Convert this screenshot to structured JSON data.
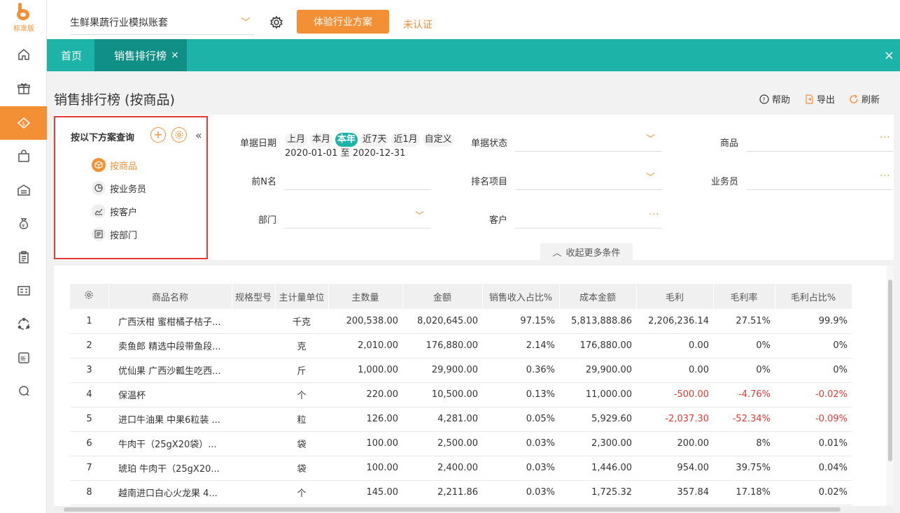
{
  "brand": {
    "logo_text": "标准版",
    "accent": "#f39036",
    "teal": "#1eb3a8"
  },
  "rail": [
    {
      "icon": "home-icon"
    },
    {
      "icon": "gift-icon"
    },
    {
      "icon": "sales-icon",
      "active": true
    },
    {
      "icon": "shopping-bag-icon"
    },
    {
      "icon": "warehouse-icon"
    },
    {
      "icon": "money-bag-icon"
    },
    {
      "icon": "clipboard-icon"
    },
    {
      "icon": "report-icon"
    },
    {
      "icon": "cycle-icon"
    },
    {
      "icon": "new-icon"
    },
    {
      "icon": "chat-icon"
    }
  ],
  "topbar": {
    "account_name": "生鲜果蔬行业模拟账套",
    "try_button": "体验行业方案",
    "verify_status": "未认证"
  },
  "tabs": {
    "home": "首页",
    "active": "销售排行榜",
    "close": "×",
    "close_all": "×"
  },
  "page": {
    "title": "销售排行榜 (按商品)",
    "help": "帮助",
    "export": "导出",
    "refresh": "刷新"
  },
  "scheme": {
    "title": "按以下方案查询",
    "add": "+",
    "collapse": "«",
    "items": [
      {
        "label": "按商品",
        "active": true
      },
      {
        "label": "按业务员"
      },
      {
        "label": "按客户"
      },
      {
        "label": "按部门"
      }
    ]
  },
  "filters": {
    "date_label": "单据日期",
    "date_chips": [
      "上月",
      "本月",
      "本年",
      "近7天",
      "近1月",
      "自定义"
    ],
    "date_selected": "本年",
    "date_range": "2020-01-01 至 2020-12-31",
    "status_label": "单据状态",
    "goods_label": "商品",
    "topn_label": "前N名",
    "rank_label": "排名项目",
    "salesman_label": "业务员",
    "dept_label": "部门",
    "customer_label": "客户",
    "more_toggle": "收起更多条件",
    "dots": "···"
  },
  "table": {
    "headers": [
      "商品名称",
      "规格型号",
      "主计量单位",
      "主数量",
      "金额",
      "销售收入占比%",
      "成本金额",
      "毛利",
      "毛利率",
      "毛利占比%"
    ],
    "rows": [
      [
        "1",
        "广西沃柑 蜜柑橘子桔子...",
        "",
        "千克",
        "200,538.00",
        "8,020,645.00",
        "97.15%",
        "5,813,888.86",
        "2,206,236.14",
        "27.51%",
        "99.9%"
      ],
      [
        "2",
        "卖鱼郎 精选中段带鱼段...",
        "",
        "克",
        "2,010.00",
        "176,880.00",
        "2.14%",
        "176,880.00",
        "0.00",
        "0%",
        "0%"
      ],
      [
        "3",
        "优仙果 广西沙瓤生吃西...",
        "",
        "斤",
        "1,000.00",
        "29,900.00",
        "0.36%",
        "29,900.00",
        "0.00",
        "0%",
        "0%"
      ],
      [
        "4",
        "保温杯",
        "",
        "个",
        "220.00",
        "10,500.00",
        "0.13%",
        "11,000.00",
        "-500.00",
        "-4.76%",
        "-0.02%"
      ],
      [
        "5",
        "进口牛油果 中果6粒装 ...",
        "",
        "粒",
        "126.00",
        "4,281.00",
        "0.05%",
        "5,929.60",
        "-2,037.30",
        "-52.34%",
        "-0.09%"
      ],
      [
        "6",
        "牛肉干（25gX20袋）...",
        "",
        "袋",
        "100.00",
        "2,500.00",
        "0.03%",
        "2,300.00",
        "200.00",
        "8%",
        "0.01%"
      ],
      [
        "7",
        "琥珀 牛肉干（25gX20...",
        "",
        "袋",
        "100.00",
        "2,400.00",
        "0.03%",
        "1,446.00",
        "954.00",
        "39.75%",
        "0.04%"
      ],
      [
        "8",
        "越南进口白心火龙果 4...",
        "",
        "个",
        "145.00",
        "2,211.86",
        "0.03%",
        "1,725.32",
        "357.84",
        "17.18%",
        "0.02%"
      ]
    ]
  }
}
